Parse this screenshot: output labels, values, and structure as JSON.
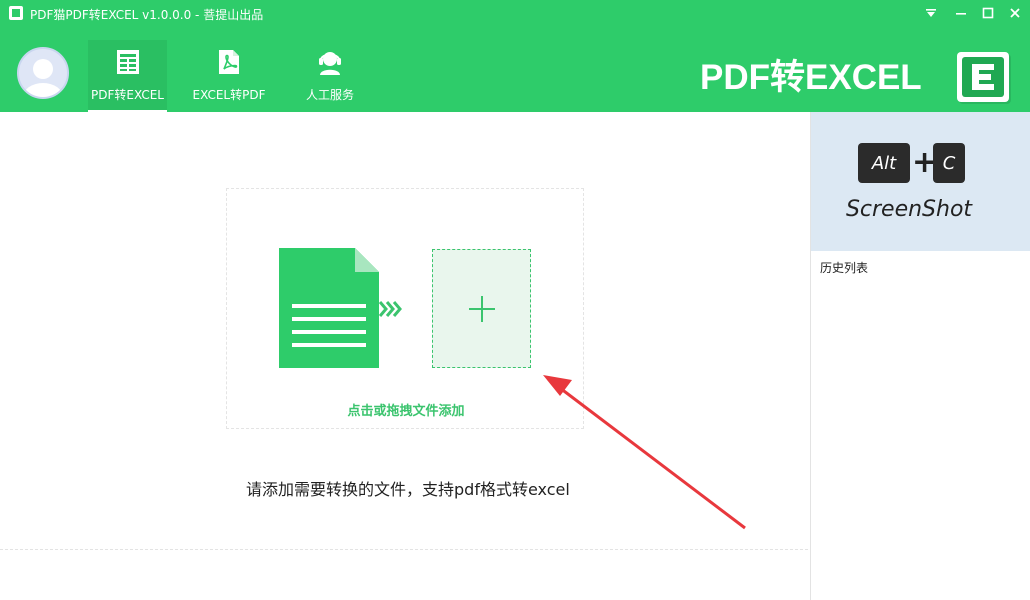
{
  "titlebar": {
    "title": "PDF猫PDF转EXCEL v1.0.0.0 - 菩提山出品"
  },
  "nav": {
    "items": [
      {
        "label": "PDF转EXCEL",
        "icon": "spreadsheet-icon",
        "active": true
      },
      {
        "label": "EXCEL转PDF",
        "icon": "pdf-icon",
        "active": false
      },
      {
        "label": "人工服务",
        "icon": "headset-icon",
        "active": false
      }
    ]
  },
  "brand": {
    "text": "PDF转EXCEL",
    "logo_letter": "E"
  },
  "main": {
    "drop_label": "点击或拖拽文件添加",
    "hint": "请添加需要转换的文件，支持pdf格式转excel"
  },
  "sidebar": {
    "shortcut_keys": [
      "Alt",
      "C"
    ],
    "shortcut_plus": "+",
    "shortcut_label": "ScreenShot",
    "history_title": "历史列表"
  },
  "colors": {
    "brand_green": "#2ecc6a",
    "accent_green": "#3bc46e",
    "annotation_red": "#e8383d"
  }
}
